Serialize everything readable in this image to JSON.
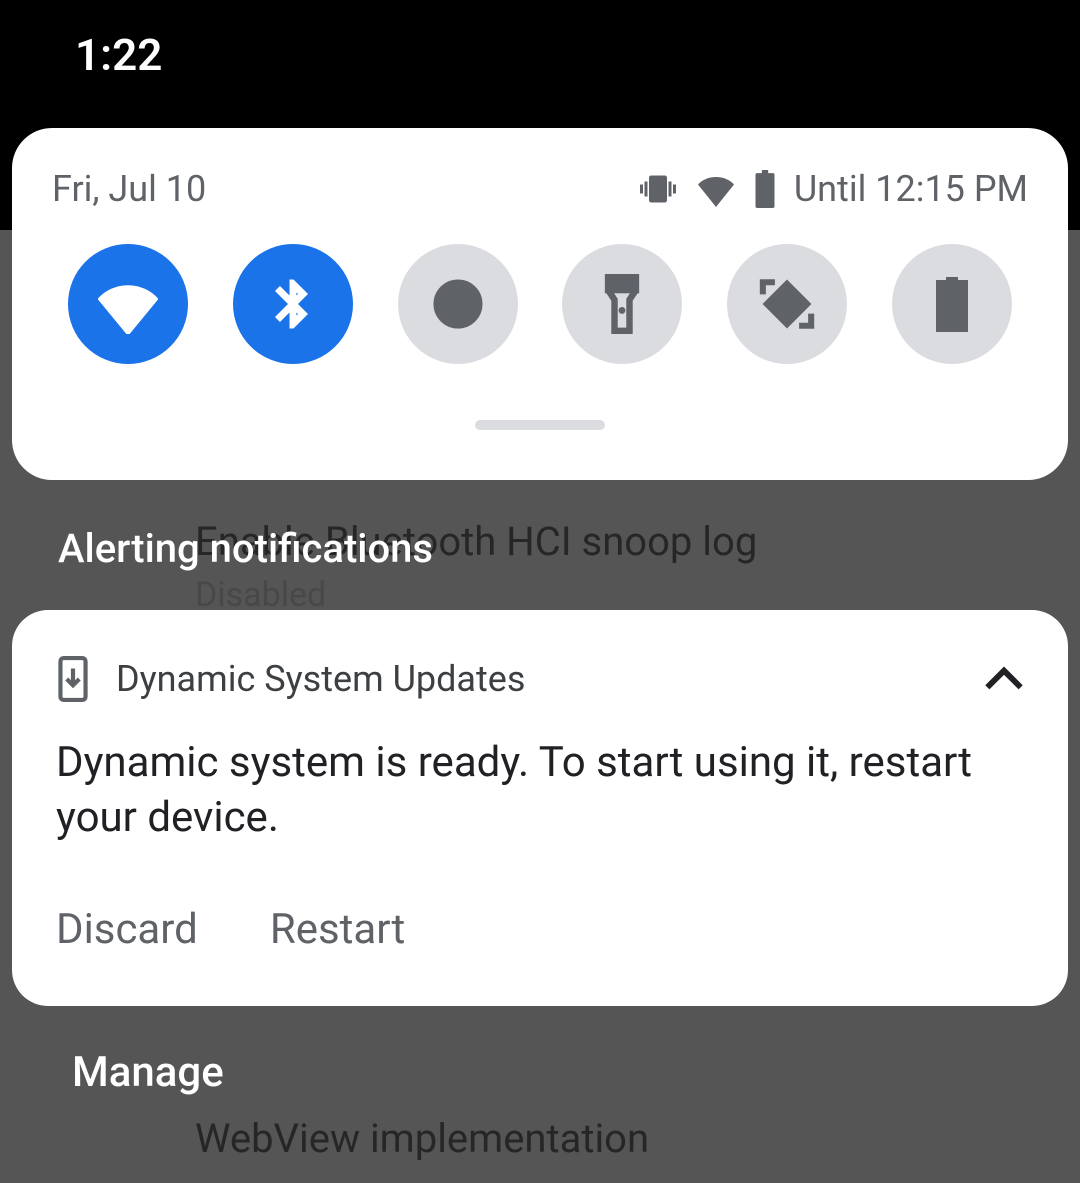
{
  "statusbar": {
    "time": "1:22"
  },
  "qs": {
    "date": "Fri, Jul 10",
    "alarm_text": "Until 12:15 PM",
    "tiles": [
      {
        "name": "wifi",
        "active": true
      },
      {
        "name": "bluetooth",
        "active": true
      },
      {
        "name": "dnd",
        "active": false
      },
      {
        "name": "flashlight",
        "active": false
      },
      {
        "name": "rotate",
        "active": false
      },
      {
        "name": "battery",
        "active": false
      }
    ]
  },
  "section_label": "Alerting notifications",
  "notification": {
    "app_name": "Dynamic System Updates",
    "message": "Dynamic system is ready. To start using it, restart your device.",
    "actions": {
      "discard": "Discard",
      "restart": "Restart"
    }
  },
  "manage_label": "Manage",
  "background_settings": {
    "item1_title": "Enable Bluetooth HCI snoop log",
    "item1_sub": "Disabled",
    "item2_title": "WebView implementation"
  }
}
